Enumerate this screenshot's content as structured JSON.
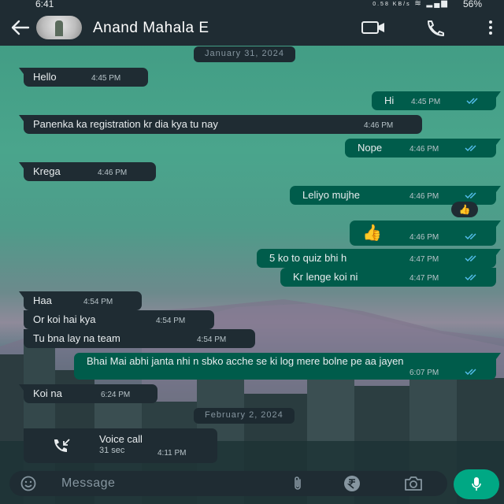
{
  "status_bar": {
    "time": "6:41",
    "data_rate": "0.58 KB/s",
    "battery": "56%"
  },
  "header": {
    "contact_name": "Anand Mahala E",
    "back_icon": "arrow-left-icon",
    "video_icon": "video-camera-icon",
    "call_icon": "phone-icon",
    "menu_icon": "more-vertical-icon"
  },
  "dates": [
    "January 31, 2024",
    "February 2, 2024"
  ],
  "messages": [
    {
      "dir": "in",
      "text": "Hello",
      "time": "4:45 PM"
    },
    {
      "dir": "out",
      "text": "Hi",
      "time": "4:45 PM"
    },
    {
      "dir": "in",
      "text": "Panenka ka registration kr dia kya tu nay",
      "time": "4:46 PM"
    },
    {
      "dir": "out",
      "text": "Nope",
      "time": "4:46 PM"
    },
    {
      "dir": "in",
      "text": "Krega",
      "time": "4:46 PM"
    },
    {
      "dir": "out",
      "text": "Leliyo mujhe",
      "time": "4:46 PM",
      "reaction": "👍"
    },
    {
      "dir": "out",
      "text": "👍",
      "time": "4:46 PM"
    },
    {
      "dir": "out",
      "text": "5 ko to quiz bhi h",
      "time": "4:47 PM"
    },
    {
      "dir": "out",
      "text": "Kr lenge koi ni",
      "time": "4:47 PM"
    },
    {
      "dir": "in",
      "text": "Haa",
      "time": "4:54 PM"
    },
    {
      "dir": "in",
      "text": "Or koi hai kya",
      "time": "4:54 PM"
    },
    {
      "dir": "in",
      "text": "Tu bna lay na team",
      "time": "4:54 PM"
    },
    {
      "dir": "out",
      "text": "Bhai Mai abhi janta nhi n sbko acche se ki log mere bolne pe aa jayen",
      "time": "6:07 PM"
    },
    {
      "dir": "in",
      "text": "Koi na",
      "time": "6:24 PM"
    }
  ],
  "voice_call": {
    "title": "Voice call",
    "duration": "31 sec",
    "time": "4:11 PM",
    "icon": "incoming-call-icon"
  },
  "input_bar": {
    "placeholder": "Message",
    "emoji_icon": "emoji-icon",
    "attach_icon": "paperclip-icon",
    "payment_icon": "rupee-icon",
    "camera_icon": "camera-icon",
    "mic_icon": "microphone-icon"
  },
  "colors": {
    "header_bg": "#1f2c33",
    "incoming_bubble": "#1f2c33",
    "outgoing_bubble": "#005c4b",
    "read_ticks": "#53bdeb",
    "mic_button": "#00a884"
  }
}
